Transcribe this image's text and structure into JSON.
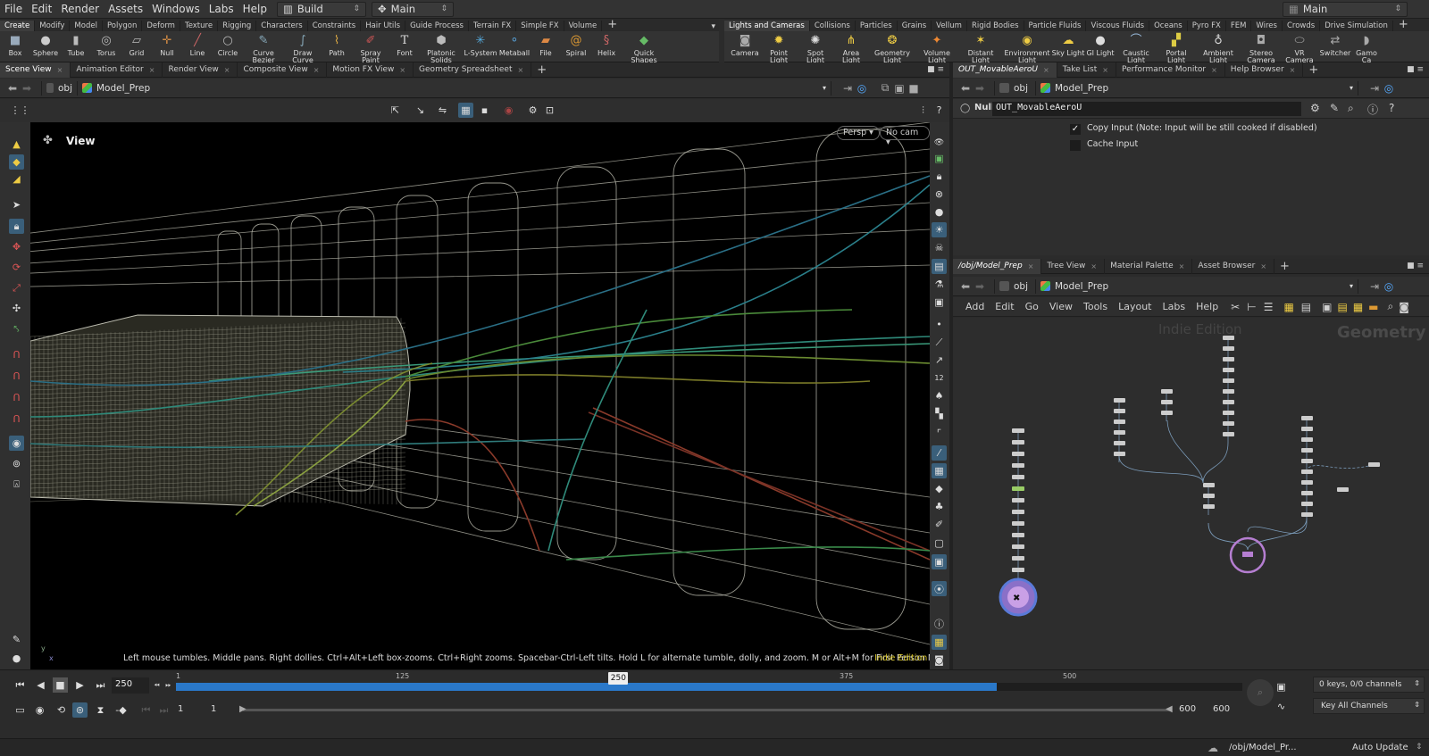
{
  "menu": {
    "items": [
      "File",
      "Edit",
      "Render",
      "Assets",
      "Windows",
      "Labs",
      "Help"
    ],
    "desktop": "Build",
    "context": "Main",
    "right_context": "Main"
  },
  "shelf_left": {
    "tabs": [
      "Create",
      "Modify",
      "Model",
      "Polygon",
      "Deform",
      "Texture",
      "Rigging",
      "Characters",
      "Constraints",
      "Hair Utils",
      "Guide Process",
      "Terrain FX",
      "Simple FX",
      "Volume"
    ],
    "tools": [
      "Box",
      "Sphere",
      "Tube",
      "Torus",
      "Grid",
      "Null",
      "Line",
      "Circle",
      "Curve Bezier",
      "Draw Curve",
      "Path",
      "Spray Paint",
      "Font",
      "Platonic Solids",
      "L-System",
      "Metaball",
      "File",
      "Spiral",
      "Helix",
      "Quick Shapes"
    ]
  },
  "shelf_right": {
    "tabs": [
      "Lights and Cameras",
      "Collisions",
      "Particles",
      "Grains",
      "Vellum",
      "Rigid Bodies",
      "Particle Fluids",
      "Viscous Fluids",
      "Oceans",
      "Pyro FX",
      "FEM",
      "Wires",
      "Crowds",
      "Drive Simulation"
    ],
    "tools": [
      "Camera",
      "Point Light",
      "Spot Light",
      "Area Light",
      "Geometry Light",
      "Volume Light",
      "Distant Light",
      "Environment Light",
      "Sky Light",
      "GI Light",
      "Caustic Light",
      "Portal Light",
      "Ambient Light",
      "Stereo Camera",
      "VR Camera",
      "Switcher",
      "Gamo Ca"
    ]
  },
  "viewer": {
    "tabs": [
      "Scene View",
      "Animation Editor",
      "Render View",
      "Composite View",
      "Motion FX View",
      "Geometry Spreadsheet"
    ],
    "path": [
      "obj",
      "Model_Prep"
    ],
    "view_label": "View",
    "persp": "Persp ▾",
    "cam": "No cam ▾",
    "hint": "Left mouse tumbles. Middle pans. Right dollies. Ctrl+Alt+Left box-zooms. Ctrl+Right zooms. Spacebar-Ctrl-Left tilts. Hold L for alternate tumble, dolly, and zoom. M or Alt+M for First Person Navigation.",
    "edition": "Indie Edition",
    "axis_y": "y",
    "axis_x": "x"
  },
  "params": {
    "tabs": [
      "OUT_MovableAeroU",
      "Take List",
      "Performance Monitor",
      "Help Browser"
    ],
    "path": [
      "obj",
      "Model_Prep"
    ],
    "node_type": "Null",
    "node_name": "OUT_MovableAeroU",
    "copy_input": "Copy Input (Note: Input will be still cooked if disabled)",
    "cache_input": "Cache Input"
  },
  "network": {
    "tabs": [
      "/obj/Model_Prep",
      "Tree View",
      "Material Palette",
      "Asset Browser"
    ],
    "path": [
      "obj",
      "Model_Prep"
    ],
    "menu": [
      "Add",
      "Edit",
      "Go",
      "View",
      "Tools",
      "Layout",
      "Labs",
      "Help"
    ],
    "watermark": "Indie Edition",
    "context_label": "Geometry"
  },
  "timeline": {
    "frame": "250",
    "start": "1",
    "ticks": [
      "1",
      "125",
      "250",
      "375",
      "500"
    ],
    "range_start": "1",
    "range_start2": "1",
    "range_end": "600",
    "range_end2": "600",
    "keys": "0 keys, 0/0 channels",
    "key_all": "Key All Channels",
    "status_path": "/obj/Model_Pr...",
    "auto_update": "Auto Update",
    "playhead_fraction": 0.4149
  },
  "colors": {
    "accent": "#2a78c9",
    "edition": "#d7c427",
    "out_node": "#b57ed1"
  }
}
